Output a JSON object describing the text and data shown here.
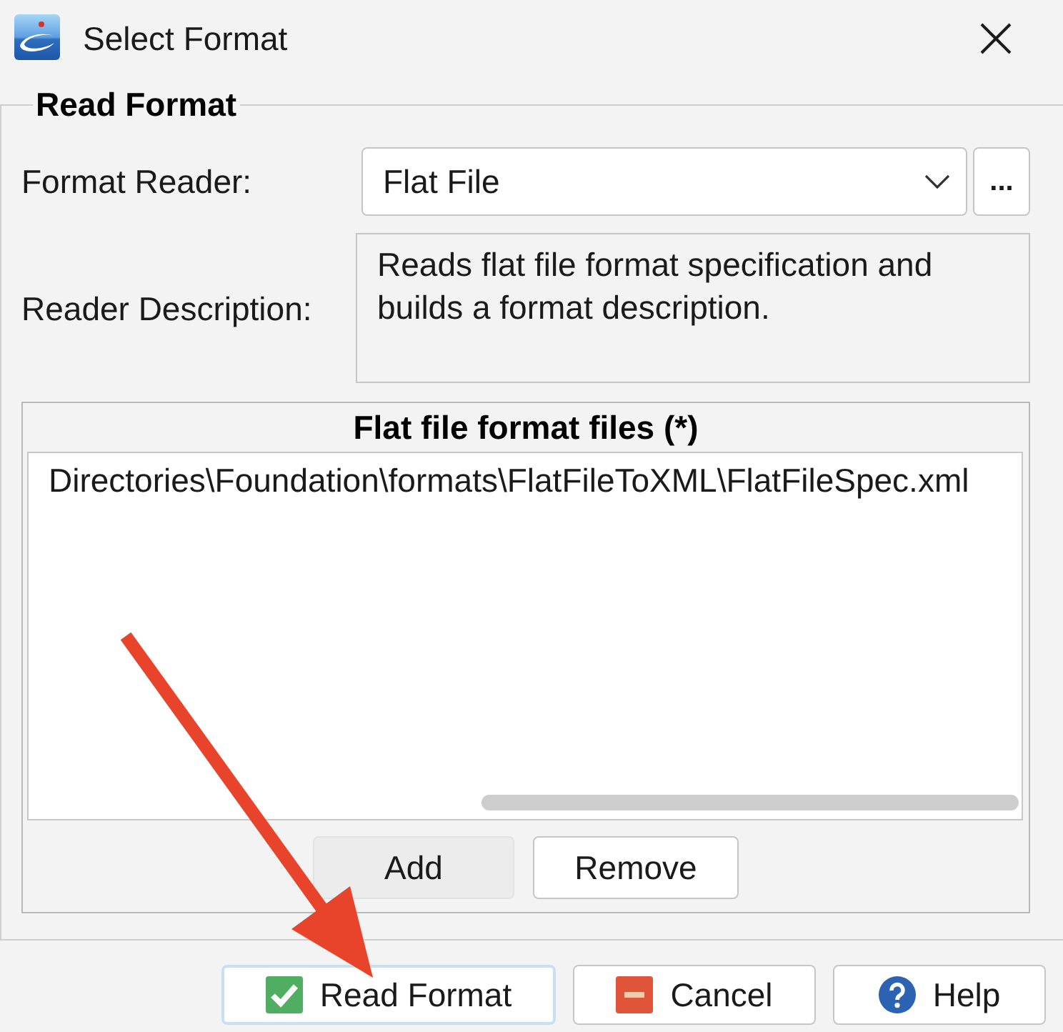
{
  "window": {
    "title": "Select Format"
  },
  "read_format_group": {
    "title": "Read Format",
    "format_reader": {
      "label": "Format Reader:",
      "value": "Flat File",
      "browse_button": "..."
    },
    "reader_description": {
      "label": "Reader Description:",
      "text": "Reads flat file format specification and builds a format description."
    },
    "files_list": {
      "header": "Flat file format files (*)",
      "rows": [
        "Directories\\Foundation\\formats\\FlatFileToXML\\FlatFileSpec.xml"
      ],
      "buttons": [
        {
          "label": "Add",
          "highlighted": true
        },
        {
          "label": "Remove",
          "highlighted": false
        }
      ]
    }
  },
  "buttons": [
    {
      "label": "Read Format",
      "kind": "ok",
      "focused": true
    },
    {
      "label": "Cancel",
      "kind": "cancel",
      "focused": false
    },
    {
      "label": "Help",
      "kind": "help",
      "focused": false
    }
  ]
}
